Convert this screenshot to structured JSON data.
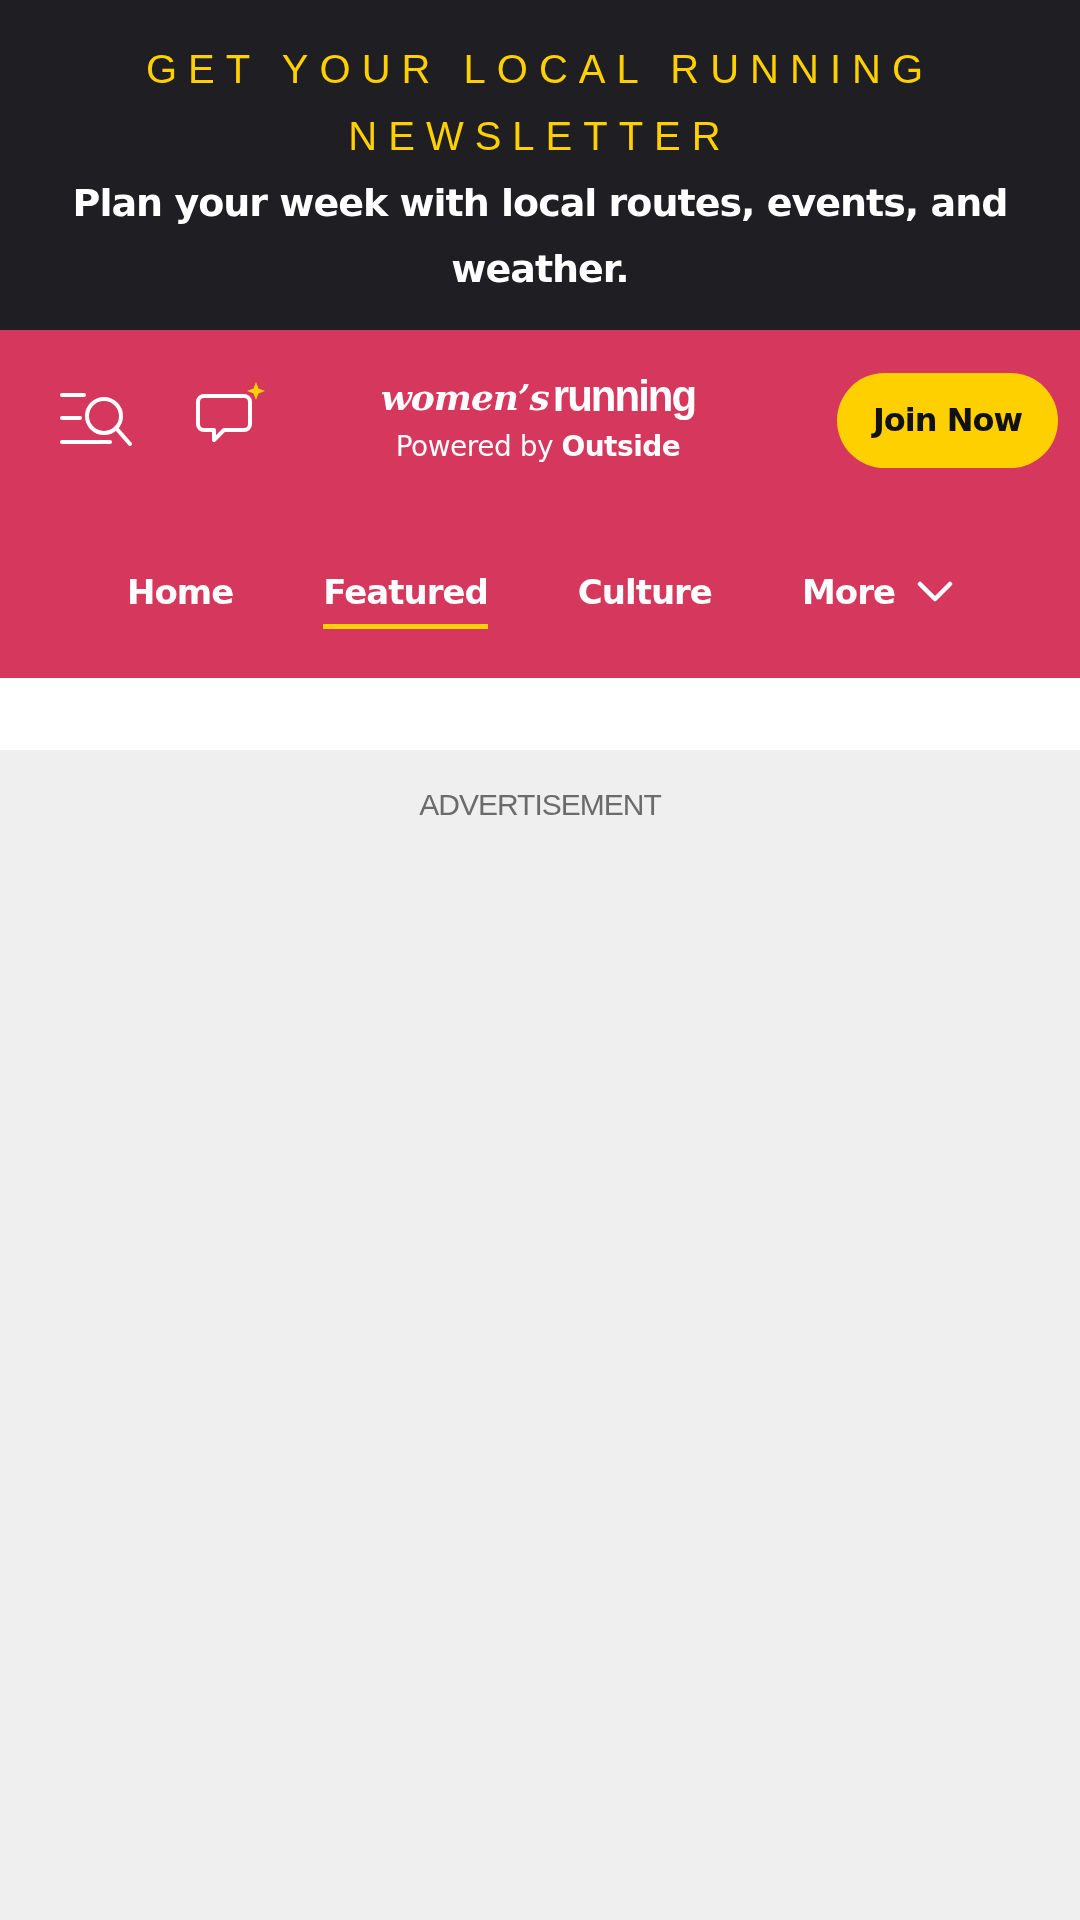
{
  "banner": {
    "title": "GET YOUR LOCAL RUNNING NEWSLETTER",
    "subtitle": "Plan your week with local routes, events, and weather."
  },
  "header": {
    "logo": {
      "part_1": "women’s",
      "part_2": "running"
    },
    "tagline": "Powered by **Outside**",
    "join_button": "Join Now"
  },
  "nav": [
    {
      "label": "Home",
      "selected": false,
      "dropdown": false
    },
    {
      "label": "Featured",
      "selected": true,
      "dropdown": false
    },
    {
      "label": "Culture",
      "selected": false,
      "dropdown": false
    },
    {
      "label": "More",
      "selected": false,
      "dropdown": true
    }
  ],
  "ad": {
    "label": "ADVERTISEMENT"
  }
}
